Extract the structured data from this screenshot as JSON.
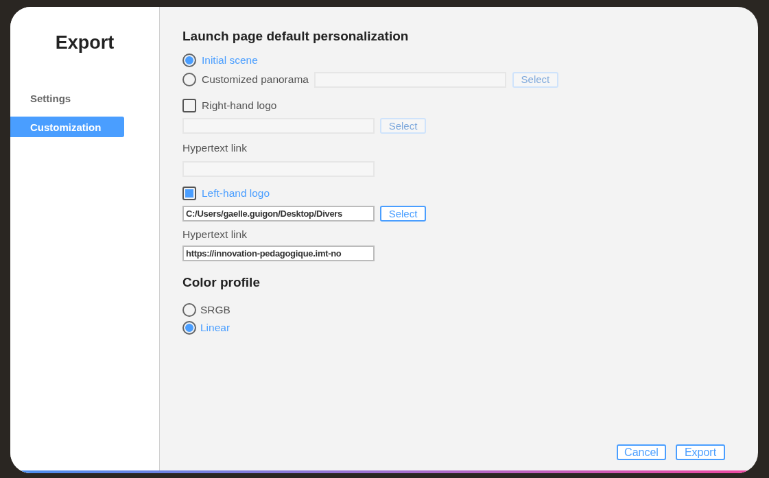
{
  "dialog": {
    "title": "Export"
  },
  "sidebar": {
    "items": [
      {
        "label": "Settings",
        "selected": false
      },
      {
        "label": "Customization",
        "selected": true
      }
    ]
  },
  "launch_page": {
    "heading": "Launch page default personalization",
    "options": [
      {
        "kind": "plain",
        "label": "Initial scene",
        "selected": true
      },
      {
        "kind": "file",
        "label": "Customized panorama",
        "selected": false,
        "select_button": {
          "label": "Select",
          "disabled": true
        }
      }
    ]
  },
  "logos": [
    {
      "label": "Right-hand logo",
      "checked": false,
      "select_button": {
        "label": "Select",
        "disabled": true
      },
      "link_label": "Hypertext link"
    },
    {
      "label": "Left-hand logo",
      "checked": true,
      "path": "C:/Users/gaelle.guigon/Desktop/Divers",
      "select_button": {
        "label": "Select",
        "disabled": false
      },
      "link_label": "Hypertext link",
      "link": "https://innovation-pedagogique.imt-no"
    }
  ],
  "color_profile": {
    "heading": "Color profile",
    "options": [
      {
        "label": "SRGB",
        "selected": false
      },
      {
        "label": "Linear",
        "selected": true
      }
    ]
  },
  "buttons": [
    {
      "label": "Cancel"
    },
    {
      "label": "Export"
    }
  ]
}
